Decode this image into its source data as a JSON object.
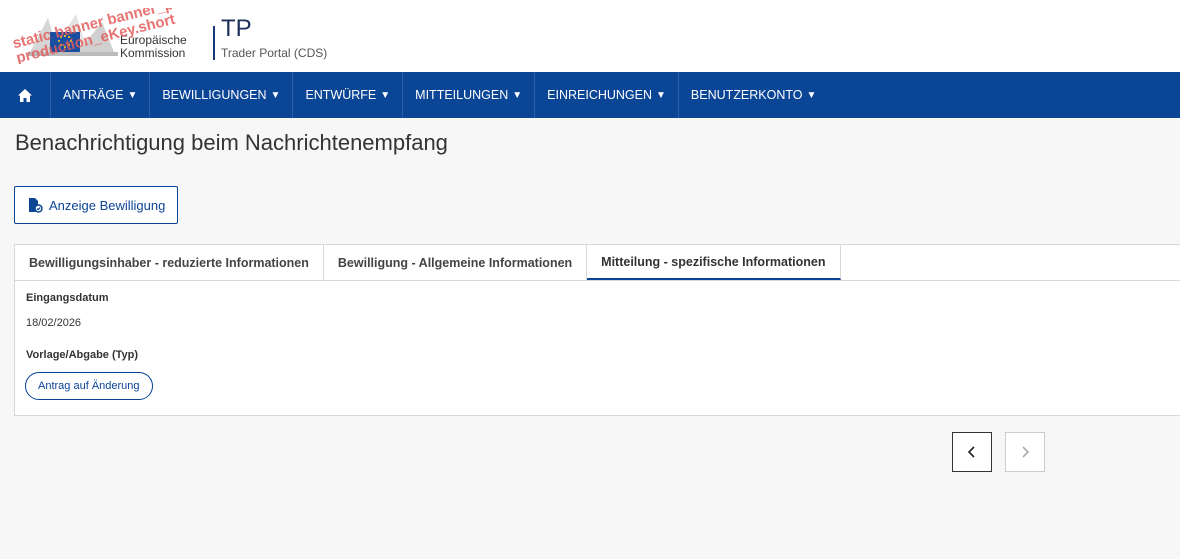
{
  "header": {
    "banner_overlay": "static banner banner_pre-\nproduction_eKey.short",
    "ec_name_line1": "Europäische",
    "ec_name_line2": "Kommission",
    "app_title": "TP",
    "app_subtitle": "Trader Portal (CDS)"
  },
  "nav": {
    "home_icon": "home-icon",
    "items": [
      {
        "label": "ANTRÄGE"
      },
      {
        "label": "BEWILLIGUNGEN"
      },
      {
        "label": "ENTWÜRFE"
      },
      {
        "label": "MITTEILUNGEN"
      },
      {
        "label": "EINREICHUNGEN"
      },
      {
        "label": "BENUTZERKONTO"
      }
    ]
  },
  "page": {
    "title": "Benachrichtigung beim Nachrichtenempfang",
    "permit_button_label": "Anzeige Bewilligung"
  },
  "tabs": [
    {
      "label": "Bewilligungsinhaber - reduzierte Informationen",
      "active": false
    },
    {
      "label": "Bewilligung - Allgemeine Informationen",
      "active": false
    },
    {
      "label": "Mitteilung - spezifische Informationen",
      "active": true
    }
  ],
  "details": {
    "receipt_date_label": "Eingangsdatum",
    "receipt_date_value": "18/02/2026",
    "submission_type_label": "Vorlage/Abgabe (Typ)",
    "submission_type_value": "Antrag auf Änderung"
  },
  "pager": {
    "prev_symbol": "‹",
    "next_symbol": "›"
  },
  "colors": {
    "nav_bg": "#0b4596",
    "accent": "#0b4596",
    "banner_text": "#e35b5b"
  }
}
